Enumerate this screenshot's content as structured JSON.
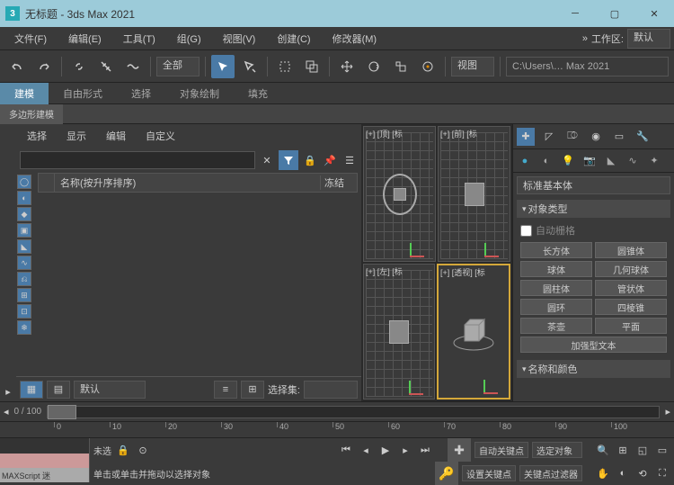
{
  "titlebar": {
    "logo": "3",
    "title": "无标题 - 3ds Max 2021"
  },
  "menu": {
    "file": "文件(F)",
    "edit": "编辑(E)",
    "tools": "工具(T)",
    "group": "组(G)",
    "views": "视图(V)",
    "create": "创建(C)",
    "modifiers": "修改器(M)",
    "workspace_label": "工作区:",
    "workspace_value": "默认"
  },
  "toolbar": {
    "scope": "全部",
    "viewdd": "视图",
    "path": "C:\\Users\\… Max 2021"
  },
  "ribbon": {
    "modeling": "建模",
    "freeform": "自由形式",
    "select": "选择",
    "objpaint": "对象绘制",
    "fill": "填充",
    "poly": "多边形建模"
  },
  "scene": {
    "tabs": {
      "select": "选择",
      "display": "显示",
      "edit": "编辑",
      "custom": "自定义"
    },
    "search_placeholder": "",
    "col_name": "名称(按升序排序)",
    "col_freeze": "冻结",
    "selset_label": "选择集:",
    "layer": "默认"
  },
  "viewports": {
    "top": "[+] [顶] [标",
    "front": "[+] [前] [标",
    "left": "[+] [左] [标",
    "persp": "[+] [透视] [标"
  },
  "cmd": {
    "category": "标准基本体",
    "objtype": "对象类型",
    "autogrid": "自动栅格",
    "btns": {
      "box": "长方体",
      "cone": "圆锥体",
      "sphere": "球体",
      "geo": "几何球体",
      "cyl": "圆柱体",
      "tube": "管状体",
      "torus": "圆环",
      "pyr": "四棱锥",
      "tea": "茶壶",
      "plane": "平面",
      "text": "加强型文本"
    },
    "namecolor": "名称和颜色"
  },
  "time": {
    "range": "0 / 100",
    "ticks": [
      0,
      10,
      20,
      30,
      40,
      50,
      60,
      70,
      80,
      90,
      100
    ]
  },
  "status": {
    "maxscript": "MAXScript 迷",
    "untitled": "未选",
    "prompt": "单击或单击并拖动以选择对象",
    "autokey": "自动关键点",
    "selected": "选定对象",
    "setkey": "设置关键点",
    "keyfilters": "关键点过滤器"
  }
}
